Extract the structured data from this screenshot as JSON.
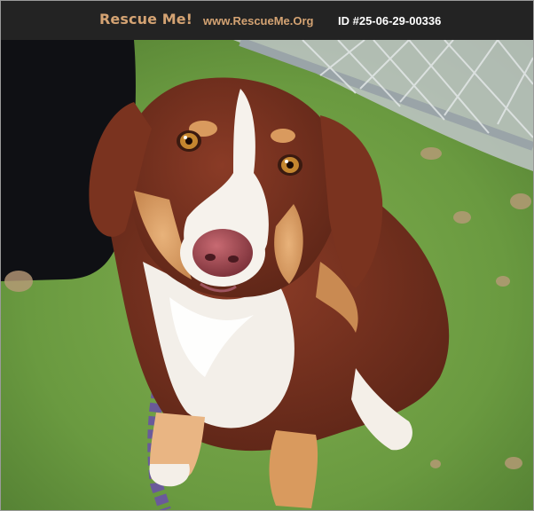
{
  "header": {
    "logo_text": "Rescue Me!",
    "site_url": "www.RescueMe.Org",
    "listing_id": "ID #25-06-29-00336"
  },
  "colors": {
    "header_bg": "#232323",
    "brand_gold": "#d4a373",
    "id_text": "#ffffff",
    "grass": "#6f9a46"
  },
  "photo": {
    "subject_icon": "dog-photo"
  }
}
